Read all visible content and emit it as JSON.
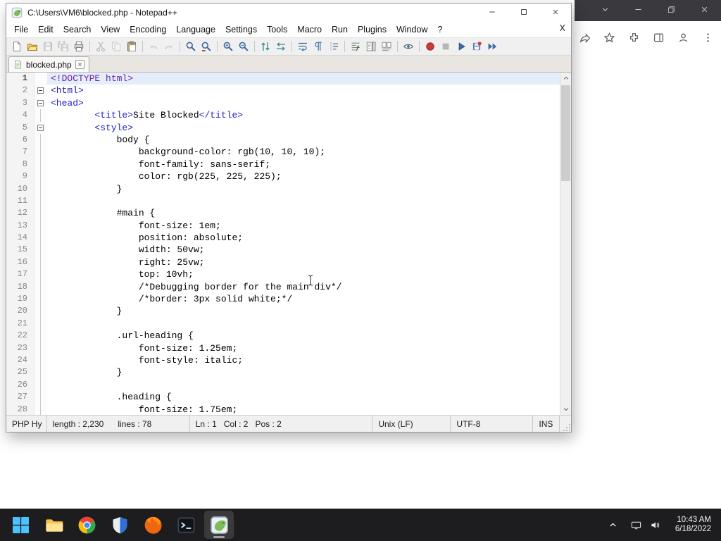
{
  "browser": {
    "titlebar_controls": [
      "chevron-down",
      "minimize",
      "restore",
      "close"
    ],
    "toolbar_icons": [
      "share",
      "favorites-star",
      "extensions-puzzle",
      "split-screen",
      "profile",
      "more-options"
    ]
  },
  "window": {
    "title": "C:\\Users\\VM6\\blocked.php - Notepad++",
    "controls": [
      "minimize",
      "maximize",
      "close"
    ],
    "menu_bar": {
      "items": [
        "File",
        "Edit",
        "Search",
        "View",
        "Encoding",
        "Language",
        "Settings",
        "Tools",
        "Macro",
        "Run",
        "Plugins",
        "Window",
        "?"
      ],
      "close_label": "X"
    },
    "toolbar": {
      "groups": [
        [
          "new-file",
          "open-file",
          "save",
          "save-all",
          "print"
        ],
        [
          "cut",
          "copy",
          "paste"
        ],
        [
          "undo",
          "redo"
        ],
        [
          "find",
          "replace"
        ],
        [
          "zoom-in",
          "zoom-out"
        ],
        [
          "sync-vertical",
          "sync-horizontal"
        ],
        [
          "word-wrap",
          "show-all-characters",
          "show-indent-guide"
        ],
        [
          "function-list",
          "document-map",
          "document-list"
        ],
        [
          "monitoring"
        ],
        [
          "record-macro",
          "stop-macro",
          "playback-macro",
          "save-macro",
          "run-macro"
        ]
      ],
      "disabled": [
        "save",
        "save-all",
        "cut",
        "copy",
        "undo",
        "redo",
        "stop-macro"
      ]
    },
    "tab": {
      "label": "blocked.php"
    }
  },
  "editor": {
    "lines": [
      {
        "n": 1,
        "fold": "",
        "cur": true,
        "seg": [
          {
            "c": "doctype",
            "t": "<!DOCTYPE html>"
          }
        ]
      },
      {
        "n": 2,
        "fold": "box",
        "seg": [
          {
            "c": "tag",
            "t": "<html>"
          }
        ]
      },
      {
        "n": 3,
        "fold": "box",
        "seg": [
          {
            "c": "tag",
            "t": "<head>"
          }
        ]
      },
      {
        "n": 4,
        "fold": "line",
        "seg": [
          {
            "c": "plain",
            "t": "        "
          },
          {
            "c": "tag",
            "t": "<title>"
          },
          {
            "c": "plain",
            "t": "Site Blocked"
          },
          {
            "c": "tag",
            "t": "</title>"
          }
        ]
      },
      {
        "n": 5,
        "fold": "box",
        "seg": [
          {
            "c": "plain",
            "t": "        "
          },
          {
            "c": "tag",
            "t": "<style>"
          }
        ]
      },
      {
        "n": 6,
        "fold": "line",
        "seg": [
          {
            "c": "plain",
            "t": "            body {"
          }
        ]
      },
      {
        "n": 7,
        "fold": "line",
        "seg": [
          {
            "c": "plain",
            "t": "                background-color: rgb(10, 10, 10);"
          }
        ]
      },
      {
        "n": 8,
        "fold": "line",
        "seg": [
          {
            "c": "plain",
            "t": "                font-family: sans-serif;"
          }
        ]
      },
      {
        "n": 9,
        "fold": "line",
        "seg": [
          {
            "c": "plain",
            "t": "                color: rgb(225, 225, 225);"
          }
        ]
      },
      {
        "n": 10,
        "fold": "line",
        "seg": [
          {
            "c": "plain",
            "t": "            }"
          }
        ]
      },
      {
        "n": 11,
        "fold": "line",
        "seg": []
      },
      {
        "n": 12,
        "fold": "line",
        "seg": [
          {
            "c": "plain",
            "t": "            #main {"
          }
        ]
      },
      {
        "n": 13,
        "fold": "line",
        "seg": [
          {
            "c": "plain",
            "t": "                font-size: 1em;"
          }
        ]
      },
      {
        "n": 14,
        "fold": "line",
        "seg": [
          {
            "c": "plain",
            "t": "                position: absolute;"
          }
        ]
      },
      {
        "n": 15,
        "fold": "line",
        "seg": [
          {
            "c": "plain",
            "t": "                width: 50vw;"
          }
        ]
      },
      {
        "n": 16,
        "fold": "line",
        "seg": [
          {
            "c": "plain",
            "t": "                right: 25vw;"
          }
        ]
      },
      {
        "n": 17,
        "fold": "line",
        "seg": [
          {
            "c": "plain",
            "t": "                top: 10vh;"
          }
        ]
      },
      {
        "n": 18,
        "fold": "line",
        "seg": [
          {
            "c": "plain",
            "t": "                /*Debugging border for the main div*/"
          }
        ]
      },
      {
        "n": 19,
        "fold": "line",
        "seg": [
          {
            "c": "plain",
            "t": "                /*border: 3px solid white;*/"
          }
        ]
      },
      {
        "n": 20,
        "fold": "line",
        "seg": [
          {
            "c": "plain",
            "t": "            }"
          }
        ]
      },
      {
        "n": 21,
        "fold": "line",
        "seg": []
      },
      {
        "n": 22,
        "fold": "line",
        "seg": [
          {
            "c": "plain",
            "t": "            .url-heading {"
          }
        ]
      },
      {
        "n": 23,
        "fold": "line",
        "seg": [
          {
            "c": "plain",
            "t": "                font-size: 1.25em;"
          }
        ]
      },
      {
        "n": 24,
        "fold": "line",
        "seg": [
          {
            "c": "plain",
            "t": "                font-style: italic;"
          }
        ]
      },
      {
        "n": 25,
        "fold": "line",
        "seg": [
          {
            "c": "plain",
            "t": "            }"
          }
        ]
      },
      {
        "n": 26,
        "fold": "line",
        "seg": []
      },
      {
        "n": 27,
        "fold": "line",
        "seg": [
          {
            "c": "plain",
            "t": "            .heading {"
          }
        ]
      },
      {
        "n": 28,
        "fold": "line",
        "seg": [
          {
            "c": "plain",
            "t": "                font-size: 1.75em;"
          }
        ]
      }
    ]
  },
  "status_bar": {
    "doc_type": "PHP Hy",
    "length": "length : 2,230",
    "lines": "lines : 78",
    "position": "Ln : 1   Col : 2   Pos : 2",
    "eol": "Unix (LF)",
    "encoding": "UTF-8",
    "typing_mode": "INS"
  },
  "taskbar": {
    "apps": [
      {
        "name": "start",
        "active": false
      },
      {
        "name": "file-explorer",
        "active": false
      },
      {
        "name": "chrome",
        "active": false
      },
      {
        "name": "security-shield",
        "active": false
      },
      {
        "name": "firefox",
        "active": false
      },
      {
        "name": "terminal",
        "active": false
      },
      {
        "name": "notepad-plus-plus",
        "active": true
      }
    ],
    "tray_icons": [
      "chevron-up",
      "network",
      "volume"
    ],
    "clock": {
      "time": "10:43 AM",
      "date": "6/18/2022"
    }
  },
  "colors": {
    "tag": "#2023bd",
    "doctype": "#6a1fae",
    "current_line_bg": "#e4edf9",
    "taskbar_bg": "#1d1d20",
    "titlebar_strip_bg": "#3a3a3e"
  }
}
